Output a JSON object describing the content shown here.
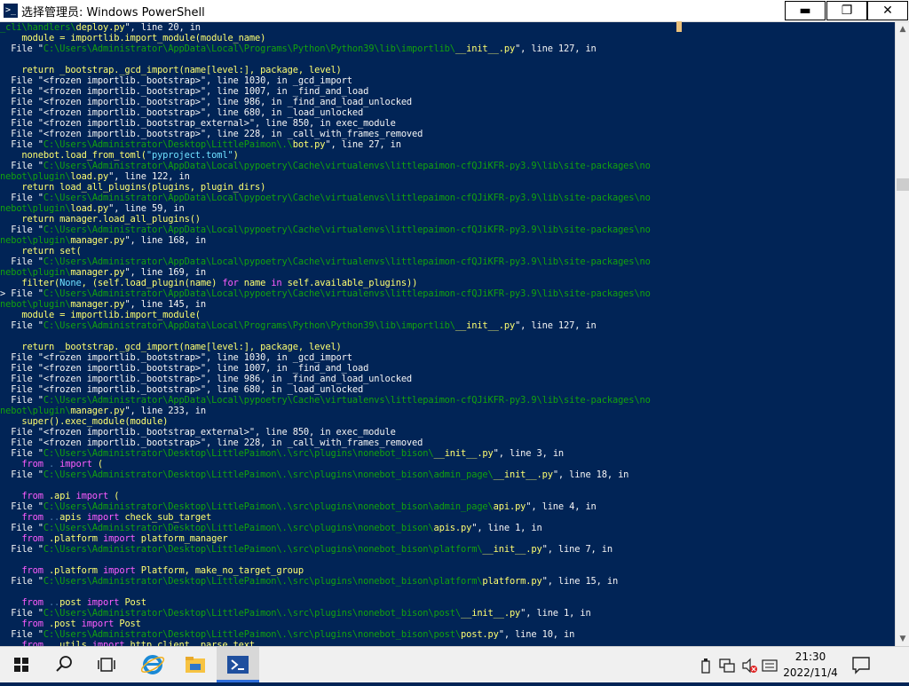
{
  "window": {
    "title": "选择管理员: Windows PowerShell",
    "icon": "powershell-icon",
    "controls": {
      "minimize": "▬",
      "maximize": "❐",
      "close": "✕"
    }
  },
  "console": {
    "lines": [
      [
        {
          "t": "_cli\\handlers\\",
          "c": "g"
        },
        {
          "t": "deploy.py",
          "c": "y"
        },
        {
          "t": "\", line 20, in",
          "c": "n"
        }
      ],
      [
        {
          "t": "    module = importlib.import_module(module_name)",
          "c": "y"
        }
      ],
      [
        {
          "t": "  File \"",
          "c": "n"
        },
        {
          "t": "C:\\Users\\Administrator\\AppData\\Local\\Programs\\Python\\Python39\\lib\\importlib\\",
          "c": "g"
        },
        {
          "t": "__init__.py",
          "c": "y"
        },
        {
          "t": "\", line 127, in",
          "c": "n"
        }
      ],
      [
        {
          "t": "",
          "c": "n"
        }
      ],
      [
        {
          "t": "    return _bootstrap._gcd_import(name[level:], package, level)",
          "c": "y"
        }
      ],
      [
        {
          "t": "  File \"<frozen importlib._bootstrap>\", line 1030, in _gcd_import",
          "c": "n"
        }
      ],
      [
        {
          "t": "  File \"<frozen importlib._bootstrap>\", line 1007, in _find_and_load",
          "c": "n"
        }
      ],
      [
        {
          "t": "  File \"<frozen importlib._bootstrap>\", line 986, in _find_and_load_unlocked",
          "c": "n"
        }
      ],
      [
        {
          "t": "  File \"<frozen importlib._bootstrap>\", line 680, in _load_unlocked",
          "c": "n"
        }
      ],
      [
        {
          "t": "  File \"<frozen importlib._bootstrap_external>\", line 850, in exec_module",
          "c": "n"
        }
      ],
      [
        {
          "t": "  File \"<frozen importlib._bootstrap>\", line 228, in _call_with_frames_removed",
          "c": "n"
        }
      ],
      [
        {
          "t": "  File \"",
          "c": "n"
        },
        {
          "t": "C:\\Users\\Administrator\\Desktop\\LittlePaimon\\.\\",
          "c": "g"
        },
        {
          "t": "bot.py",
          "c": "y"
        },
        {
          "t": "\", line 27, in",
          "c": "n"
        }
      ],
      [
        {
          "t": "    nonebot.load_from_toml(",
          "c": "y"
        },
        {
          "t": "\"pyproject.toml\"",
          "c": "c"
        },
        {
          "t": ")",
          "c": "y"
        }
      ],
      [
        {
          "t": "  File \"",
          "c": "n"
        },
        {
          "t": "C:\\Users\\Administrator\\AppData\\Local\\pypoetry\\Cache\\virtualenvs\\littlepaimon-cfQJiKFR-py3.9\\lib\\site-packages\\no",
          "c": "g"
        }
      ],
      [
        {
          "t": "nebot\\plugin\\",
          "c": "g"
        },
        {
          "t": "load.py",
          "c": "y"
        },
        {
          "t": "\", line 122, in",
          "c": "n"
        }
      ],
      [
        {
          "t": "    return load_all_plugins(plugins, plugin_dirs)",
          "c": "y"
        }
      ],
      [
        {
          "t": "  File \"",
          "c": "n"
        },
        {
          "t": "C:\\Users\\Administrator\\AppData\\Local\\pypoetry\\Cache\\virtualenvs\\littlepaimon-cfQJiKFR-py3.9\\lib\\site-packages\\no",
          "c": "g"
        }
      ],
      [
        {
          "t": "nebot\\plugin\\",
          "c": "g"
        },
        {
          "t": "load.py",
          "c": "y"
        },
        {
          "t": "\", line 59, in",
          "c": "n"
        }
      ],
      [
        {
          "t": "    return manager.load_all_plugins()",
          "c": "y"
        }
      ],
      [
        {
          "t": "  File \"",
          "c": "n"
        },
        {
          "t": "C:\\Users\\Administrator\\AppData\\Local\\pypoetry\\Cache\\virtualenvs\\littlepaimon-cfQJiKFR-py3.9\\lib\\site-packages\\no",
          "c": "g"
        }
      ],
      [
        {
          "t": "nebot\\plugin\\",
          "c": "g"
        },
        {
          "t": "manager.py",
          "c": "y"
        },
        {
          "t": "\", line 168, in",
          "c": "n"
        }
      ],
      [
        {
          "t": "    return set(",
          "c": "y"
        }
      ],
      [
        {
          "t": "  File \"",
          "c": "n"
        },
        {
          "t": "C:\\Users\\Administrator\\AppData\\Local\\pypoetry\\Cache\\virtualenvs\\littlepaimon-cfQJiKFR-py3.9\\lib\\site-packages\\no",
          "c": "g"
        }
      ],
      [
        {
          "t": "nebot\\plugin\\",
          "c": "g"
        },
        {
          "t": "manager.py",
          "c": "y"
        },
        {
          "t": "\", line 169, in",
          "c": "n"
        }
      ],
      [
        {
          "t": "    filter(",
          "c": "y"
        },
        {
          "t": "None",
          "c": "c"
        },
        {
          "t": ", (self.load_plugin(name) ",
          "c": "y"
        },
        {
          "t": "for",
          "c": "m"
        },
        {
          "t": " name ",
          "c": "y"
        },
        {
          "t": "in",
          "c": "m"
        },
        {
          "t": " self.available_plugins))",
          "c": "y"
        }
      ],
      [
        {
          "t": "> File \"",
          "c": "n"
        },
        {
          "t": "C:\\Users\\Administrator\\AppData\\Local\\pypoetry\\Cache\\virtualenvs\\littlepaimon-cfQJiKFR-py3.9\\lib\\site-packages\\no",
          "c": "g"
        }
      ],
      [
        {
          "t": "nebot\\plugin\\",
          "c": "g"
        },
        {
          "t": "manager.py",
          "c": "y"
        },
        {
          "t": "\", line 145, in",
          "c": "n"
        }
      ],
      [
        {
          "t": "    module = importlib.import_module(",
          "c": "y"
        }
      ],
      [
        {
          "t": "  File \"",
          "c": "n"
        },
        {
          "t": "C:\\Users\\Administrator\\AppData\\Local\\Programs\\Python\\Python39\\lib\\importlib\\",
          "c": "g"
        },
        {
          "t": "__init__.py",
          "c": "y"
        },
        {
          "t": "\", line 127, in",
          "c": "n"
        }
      ],
      [
        {
          "t": "",
          "c": "n"
        }
      ],
      [
        {
          "t": "    return _bootstrap._gcd_import(name[level:], package, level)",
          "c": "y"
        }
      ],
      [
        {
          "t": "  File \"<frozen importlib._bootstrap>\", line 1030, in _gcd_import",
          "c": "n"
        }
      ],
      [
        {
          "t": "  File \"<frozen importlib._bootstrap>\", line 1007, in _find_and_load",
          "c": "n"
        }
      ],
      [
        {
          "t": "  File \"<frozen importlib._bootstrap>\", line 986, in _find_and_load_unlocked",
          "c": "n"
        }
      ],
      [
        {
          "t": "  File \"<frozen importlib._bootstrap>\", line 680, in _load_unlocked",
          "c": "n"
        }
      ],
      [
        {
          "t": "  File \"",
          "c": "n"
        },
        {
          "t": "C:\\Users\\Administrator\\AppData\\Local\\pypoetry\\Cache\\virtualenvs\\littlepaimon-cfQJiKFR-py3.9\\lib\\site-packages\\no",
          "c": "g"
        }
      ],
      [
        {
          "t": "nebot\\plugin\\",
          "c": "g"
        },
        {
          "t": "manager.py",
          "c": "y"
        },
        {
          "t": "\", line 233, in",
          "c": "n"
        }
      ],
      [
        {
          "t": "    super().exec_module(module)",
          "c": "y"
        }
      ],
      [
        {
          "t": "  File \"<frozen importlib._bootstrap_external>\", line 850, in exec_module",
          "c": "n"
        }
      ],
      [
        {
          "t": "  File \"<frozen importlib._bootstrap>\", line 228, in _call_with_frames_removed",
          "c": "n"
        }
      ],
      [
        {
          "t": "  File \"",
          "c": "n"
        },
        {
          "t": "C:\\Users\\Administrator\\Desktop\\LittlePaimon\\.\\src\\plugins\\nonebot_bison\\",
          "c": "g"
        },
        {
          "t": "__init__.py",
          "c": "y"
        },
        {
          "t": "\", line 3, in",
          "c": "n"
        }
      ],
      [
        {
          "t": "    from ",
          "c": "m"
        },
        {
          "t": ". ",
          "c": "d"
        },
        {
          "t": "import",
          "c": "m"
        },
        {
          "t": " (",
          "c": "y"
        }
      ],
      [
        {
          "t": "  File \"",
          "c": "n"
        },
        {
          "t": "C:\\Users\\Administrator\\Desktop\\LittlePaimon\\.\\src\\plugins\\nonebot_bison\\admin_page\\",
          "c": "g"
        },
        {
          "t": "__init__.py",
          "c": "y"
        },
        {
          "t": "\", line 18, in",
          "c": "n"
        }
      ],
      [
        {
          "t": "",
          "c": "n"
        }
      ],
      [
        {
          "t": "    from ",
          "c": "m"
        },
        {
          "t": ".api ",
          "c": "y"
        },
        {
          "t": "import",
          "c": "m"
        },
        {
          "t": " (",
          "c": "y"
        }
      ],
      [
        {
          "t": "  File \"",
          "c": "n"
        },
        {
          "t": "C:\\Users\\Administrator\\Desktop\\LittlePaimon\\.\\src\\plugins\\nonebot_bison\\admin_page\\",
          "c": "g"
        },
        {
          "t": "api.py",
          "c": "y"
        },
        {
          "t": "\", line 4, in",
          "c": "n"
        }
      ],
      [
        {
          "t": "    from ",
          "c": "m"
        },
        {
          "t": "..",
          "c": "d"
        },
        {
          "t": "apis ",
          "c": "y"
        },
        {
          "t": "import",
          "c": "m"
        },
        {
          "t": " check_sub_target",
          "c": "y"
        }
      ],
      [
        {
          "t": "  File \"",
          "c": "n"
        },
        {
          "t": "C:\\Users\\Administrator\\Desktop\\LittlePaimon\\.\\src\\plugins\\nonebot_bison\\",
          "c": "g"
        },
        {
          "t": "apis.py",
          "c": "y"
        },
        {
          "t": "\", line 1, in",
          "c": "n"
        }
      ],
      [
        {
          "t": "    from ",
          "c": "m"
        },
        {
          "t": ".platform ",
          "c": "y"
        },
        {
          "t": "import",
          "c": "m"
        },
        {
          "t": " platform_manager",
          "c": "y"
        }
      ],
      [
        {
          "t": "  File \"",
          "c": "n"
        },
        {
          "t": "C:\\Users\\Administrator\\Desktop\\LittlePaimon\\.\\src\\plugins\\nonebot_bison\\platform\\",
          "c": "g"
        },
        {
          "t": "__init__.py",
          "c": "y"
        },
        {
          "t": "\", line 7, in",
          "c": "n"
        }
      ],
      [
        {
          "t": "",
          "c": "n"
        }
      ],
      [
        {
          "t": "    from ",
          "c": "m"
        },
        {
          "t": ".platform ",
          "c": "y"
        },
        {
          "t": "import",
          "c": "m"
        },
        {
          "t": " Platform, make_no_target_group",
          "c": "y"
        }
      ],
      [
        {
          "t": "  File \"",
          "c": "n"
        },
        {
          "t": "C:\\Users\\Administrator\\Desktop\\LittlePaimon\\.\\src\\plugins\\nonebot_bison\\platform\\",
          "c": "g"
        },
        {
          "t": "platform.py",
          "c": "y"
        },
        {
          "t": "\", line 15, in",
          "c": "n"
        }
      ],
      [
        {
          "t": "",
          "c": "n"
        }
      ],
      [
        {
          "t": "    from ",
          "c": "m"
        },
        {
          "t": "..",
          "c": "d"
        },
        {
          "t": "post ",
          "c": "y"
        },
        {
          "t": "import",
          "c": "m"
        },
        {
          "t": " Post",
          "c": "y"
        }
      ],
      [
        {
          "t": "  File \"",
          "c": "n"
        },
        {
          "t": "C:\\Users\\Administrator\\Desktop\\LittlePaimon\\.\\src\\plugins\\nonebot_bison\\post\\",
          "c": "g"
        },
        {
          "t": "__init__.py",
          "c": "y"
        },
        {
          "t": "\", line 1, in",
          "c": "n"
        }
      ],
      [
        {
          "t": "    from ",
          "c": "m"
        },
        {
          "t": ".post ",
          "c": "y"
        },
        {
          "t": "import",
          "c": "m"
        },
        {
          "t": " Post",
          "c": "y"
        }
      ],
      [
        {
          "t": "  File \"",
          "c": "n"
        },
        {
          "t": "C:\\Users\\Administrator\\Desktop\\LittlePaimon\\.\\src\\plugins\\nonebot_bison\\post\\",
          "c": "g"
        },
        {
          "t": "post.py",
          "c": "y"
        },
        {
          "t": "\", line 10, in",
          "c": "n"
        }
      ],
      [
        {
          "t": "    from ",
          "c": "m"
        },
        {
          "t": "..",
          "c": "d"
        },
        {
          "t": "utils ",
          "c": "y"
        },
        {
          "t": "import",
          "c": "m"
        },
        {
          "t": " http_client, parse_text",
          "c": "y"
        }
      ]
    ]
  },
  "colors": {
    "background": "#012456",
    "accent": "#2f6fdc"
  },
  "taskbar": {
    "start_icon": "windows-start-icon",
    "search_icon": "search-icon",
    "task_view_icon": "task-view-icon",
    "pinned": [
      "internet-explorer-icon",
      "file-explorer-icon",
      "powershell-icon"
    ],
    "tray_icons": [
      "usb-device-icon",
      "network-icon",
      "volume-muted-icon",
      "ime-icon"
    ],
    "clock": {
      "time": "21:30",
      "date": "2022/11/4"
    },
    "notification_icon": "notification-icon"
  }
}
